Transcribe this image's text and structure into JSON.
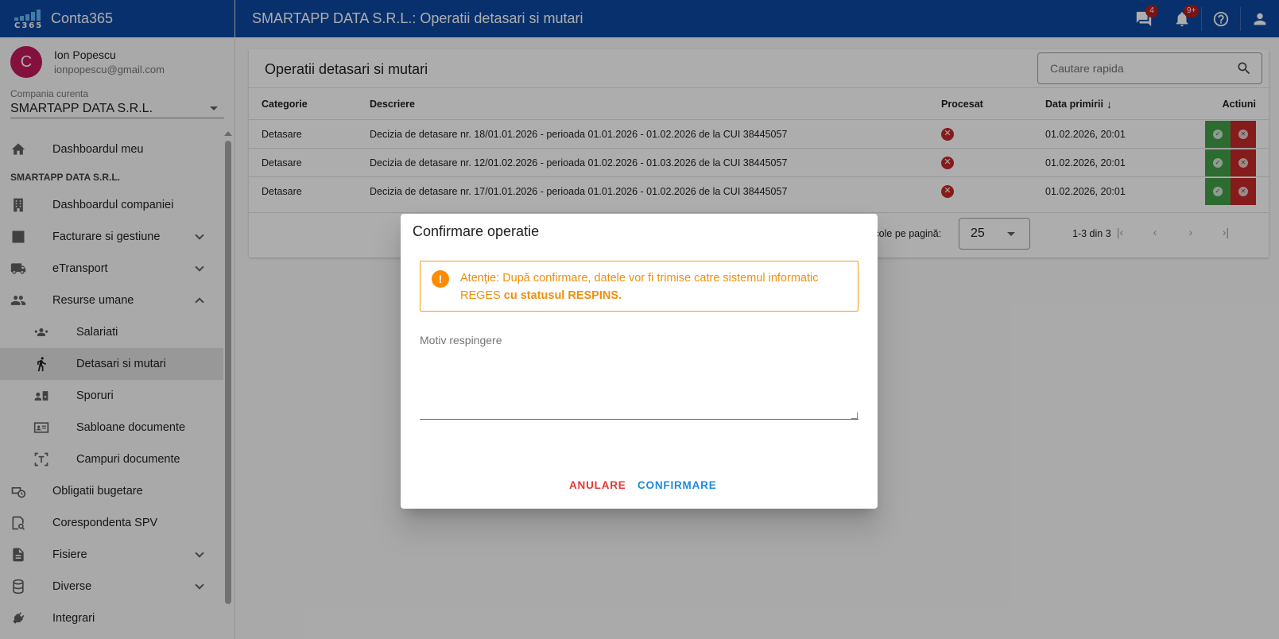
{
  "app": {
    "name": "Conta365",
    "logo_text": "C365"
  },
  "user": {
    "initial": "C",
    "name": "Ion Popescu",
    "email": "ionpopescu@gmail.com"
  },
  "company": {
    "label": "Compania curenta",
    "value": "SMARTAPP DATA S.R.L."
  },
  "sidebar": {
    "items": [
      {
        "label": "Dashboardul meu",
        "icon": "home-icon"
      },
      {
        "section": "SMARTAPP DATA S.R.L."
      },
      {
        "label": "Dashboardul companiei",
        "icon": "building-icon"
      },
      {
        "label": "Facturare si gestiune",
        "icon": "invoice-icon"
      },
      {
        "label": "eTransport",
        "icon": "truck-icon"
      },
      {
        "label": "Resurse umane",
        "icon": "people-icon"
      },
      {
        "label": "Salariati",
        "icon": "employees-icon"
      },
      {
        "label": "Detasari si mutari",
        "icon": "walking-icon"
      },
      {
        "label": "Sporuri",
        "icon": "bonus-icon"
      },
      {
        "label": "Sabloane documente",
        "icon": "template-icon"
      },
      {
        "label": "Campuri documente",
        "icon": "field-icon"
      },
      {
        "label": "Obligatii bugetare",
        "icon": "budget-icon"
      },
      {
        "label": "Corespondenta SPV",
        "icon": "mail-search-icon"
      },
      {
        "label": "Fisiere",
        "icon": "file-icon"
      },
      {
        "label": "Diverse",
        "icon": "database-icon"
      },
      {
        "label": "Integrari",
        "icon": "plug-icon"
      }
    ]
  },
  "topbar": {
    "title": "SMARTAPP DATA S.R.L.: Operatii detasari si mutari",
    "messages_badge": "4",
    "notifications_badge": "9+"
  },
  "main": {
    "title": "Operatii detasari si mutari",
    "search_placeholder": "Cautare rapida",
    "columns": [
      "Categorie",
      "Descriere",
      "Procesat",
      "Data primirii",
      "Actiuni"
    ],
    "rows": [
      {
        "category": "Detasare",
        "description": "Decizia de detasare nr. 18/01.01.2026 - perioada 01.01.2026 - 01.02.2026 de la CUI 38445057",
        "date": "01.02.2026, 20:01"
      },
      {
        "category": "Detasare",
        "description": "Decizia de detasare nr. 12/01.02.2026 - perioada 01.02.2026 - 01.03.2026 de la CUI 38445057",
        "date": "01.02.2026, 20:01"
      },
      {
        "category": "Detasare",
        "description": "Decizia de detasare nr. 17/01.01.2026 - perioada 01.01.2026 - 01.02.2026 de la CUI 38445057",
        "date": "01.02.2026, 20:01"
      }
    ],
    "paginator": {
      "per_page_label": "rticole pe pagină:",
      "per_page": "25",
      "range": "1-3 din 3"
    }
  },
  "dialog": {
    "title": "Confirmare operatie",
    "warning_text": "Atenţie: După confirmare, datele vor fi trimise catre sistemul informatic REGES ",
    "warning_bold": "cu statusul RESPINS.",
    "reason_placeholder": "Motiv respingere",
    "cancel_label": "ANULARE",
    "confirm_label": "CONFIRMARE"
  },
  "colors": {
    "primary": "#0d47a1",
    "danger": "#c62828",
    "success": "#43a047",
    "warning": "#fb8c00",
    "link": "#1e88e5"
  }
}
